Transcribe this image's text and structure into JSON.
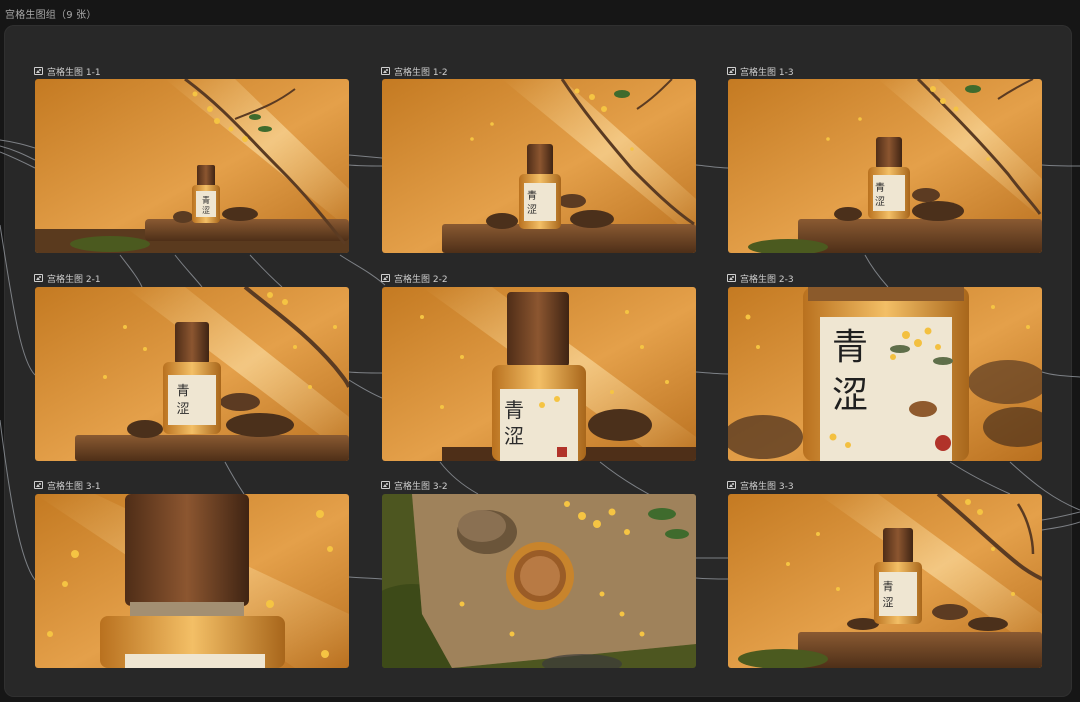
{
  "header": {
    "title": "宫格生图组（9 张）"
  },
  "label_char": "青\n涩",
  "label_line1": "青",
  "label_line2": "涩",
  "tiles": [
    {
      "label": "宫格生图 1-1"
    },
    {
      "label": "宫格生图 1-2"
    },
    {
      "label": "宫格生图 1-3"
    },
    {
      "label": "宫格生图 2-1"
    },
    {
      "label": "宫格生图 2-2"
    },
    {
      "label": "宫格生图 2-3"
    },
    {
      "label": "宫格生图 3-1"
    },
    {
      "label": "宫格生图 3-2"
    },
    {
      "label": "宫格生图 3-3"
    }
  ],
  "colors": {
    "background": "#161616",
    "panel": "#282828",
    "wire": "#8a8f96",
    "amber_light": "#f3b65a",
    "amber_dark": "#9a5a14",
    "wood": "#6b3f22"
  }
}
